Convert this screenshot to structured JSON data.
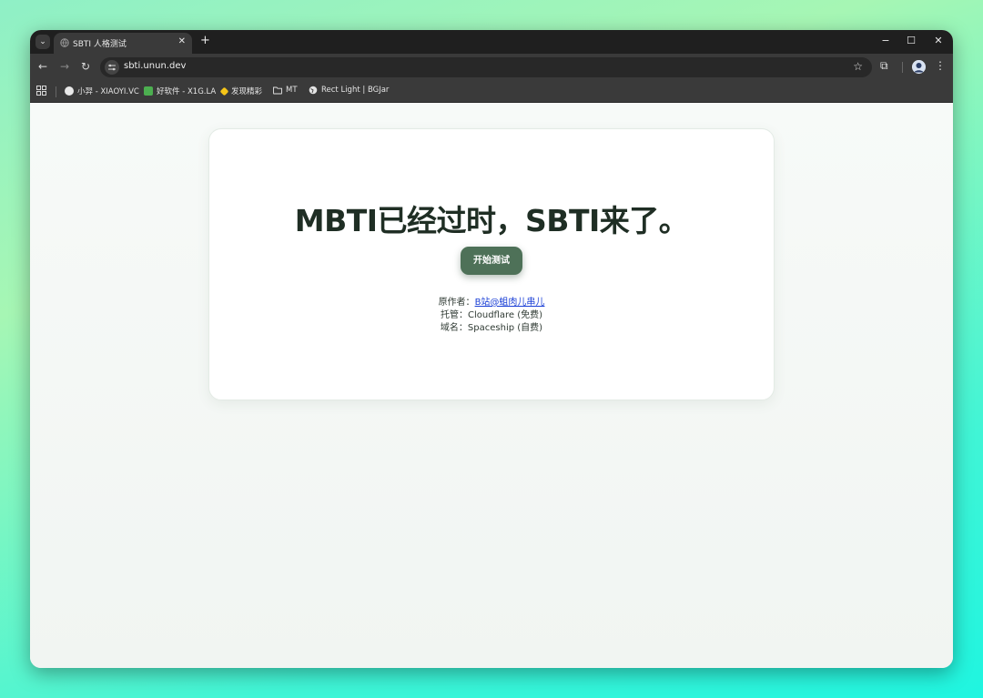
{
  "browser": {
    "tab": {
      "title": "SBTI 人格测试"
    },
    "address_bar": {
      "url": "sbti.unun.dev"
    },
    "bookmarks": [
      {
        "label": "小羿 - XIAOYI.VC",
        "icon_color": "#e8e8e8"
      },
      {
        "label": "好软件 - X1G.LA",
        "icon_color": "#4caf50"
      },
      {
        "label": "发现精彩",
        "icon_color": "#f5c518"
      },
      {
        "label": "MT",
        "icon_color": "#e4e4e4"
      },
      {
        "label": "Rect Light | BGJar",
        "icon_color": "#e4e4e4"
      }
    ]
  },
  "page": {
    "headline": "MBTI已经过时，SBTI来了。",
    "start_button": "开始测试",
    "credits": {
      "author_label": "原作者：",
      "author_link": "B站@蛆肉儿串儿",
      "hosting": "托管：Cloudflare (免费)",
      "domain": "域名：Spaceship (自费)"
    }
  },
  "colors": {
    "accent": "#4e7158",
    "headline": "#1f2e24",
    "link": "#1a3fd6"
  }
}
